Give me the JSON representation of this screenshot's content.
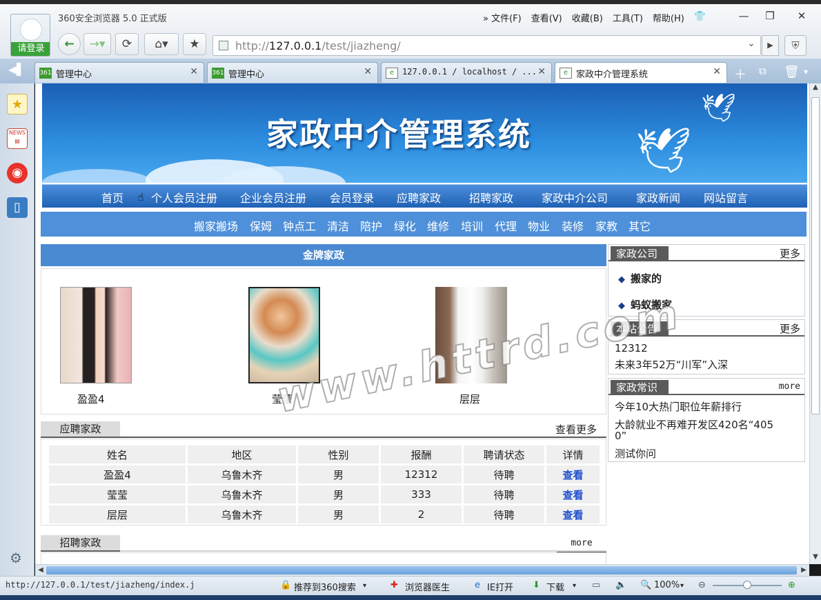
{
  "browser": {
    "app_title": "360安全浏览器 5.0 正式版",
    "login_label": "请登录",
    "menu": [
      "» 文件(F)",
      "查看(V)",
      "收藏(B)",
      "工具(T)",
      "帮助(H)"
    ],
    "url_prefix": "http://",
    "url_host": "127.0.0.1",
    "url_path": "/test/jiazheng/",
    "tabs": [
      {
        "label": "管理中心",
        "icon": "361-icon"
      },
      {
        "label": "管理中心",
        "icon": "361-icon"
      },
      {
        "label": "127.0.0.1 / localhost / ...",
        "icon": "page-icon"
      },
      {
        "label": "家政中介管理系统",
        "icon": "page-icon",
        "active": true
      }
    ]
  },
  "site": {
    "banner_title": "家政中介管理系统",
    "main_nav": [
      "首页",
      "个人会员注册",
      "企业会员注册",
      "会员登录",
      "应聘家政",
      "招聘家政",
      "家政中介公司",
      "家政新闻",
      "网站留言"
    ],
    "sub_nav": [
      "搬家搬场",
      "保姆",
      "钟点工",
      "清洁",
      "陪护",
      "绿化",
      "维修",
      "培训",
      "代理",
      "物业",
      "装修",
      "家教",
      "其它"
    ],
    "gold": {
      "title": "金牌家政",
      "people": [
        {
          "name": "盈盈4"
        },
        {
          "name": "莹莹"
        },
        {
          "name": "层层"
        }
      ]
    },
    "jobseekers": {
      "title": "应聘家政",
      "more": "查看更多",
      "columns": [
        "姓名",
        "地区",
        "性别",
        "报酬",
        "聘请状态",
        "详情"
      ],
      "rows": [
        [
          "盈盈4",
          "乌鲁木齐",
          "男",
          "12312",
          "待聘",
          "查看"
        ],
        [
          "莹莹",
          "乌鲁木齐",
          "男",
          "333",
          "待聘",
          "查看"
        ],
        [
          "层层",
          "乌鲁木齐",
          "男",
          "2",
          "待聘",
          "查看"
        ]
      ]
    },
    "recruit": {
      "title": "招聘家政",
      "more": "more"
    },
    "companies": {
      "title": "家政公司",
      "more": "更多",
      "items": [
        "搬家的",
        "蚂蚁搬家"
      ]
    },
    "notices": {
      "title": "本站公告",
      "more": "更多",
      "items": [
        "12312",
        "未来3年52万“川军”入深"
      ]
    },
    "knowledge": {
      "title": "家政常识",
      "more": "more",
      "items": [
        "今年10大热门职位年薪排行",
        "大龄就业不再难开发区420名“405",
        "0”",
        "测试你问"
      ]
    },
    "watermark": "www.httrd.com"
  },
  "status": {
    "url": "http://127.0.0.1/test/jiazheng/index.j",
    "recommend": "推荐到360搜索",
    "doctor": "浏览器医生",
    "ie_open": "IE打开",
    "download": "下载",
    "zoom": "100%"
  }
}
